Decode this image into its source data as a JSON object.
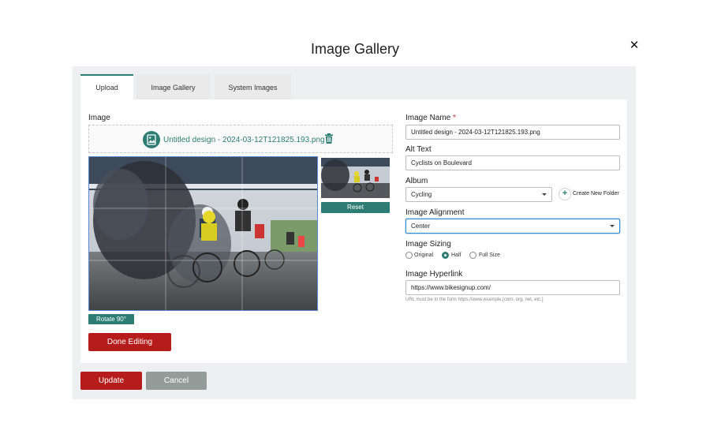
{
  "modal": {
    "title": "Image Gallery",
    "close_glyph": "✕"
  },
  "tabs": [
    {
      "label": "Upload",
      "active": true
    },
    {
      "label": "Image Gallery",
      "active": false
    },
    {
      "label": "System Images",
      "active": false
    }
  ],
  "left": {
    "image_label": "Image",
    "file_name": "Untitled design - 2024-03-12T121825.193.png",
    "reset_label": "Reset",
    "rotate_label": "Rotate 90°",
    "done_label": "Done Editing"
  },
  "right": {
    "image_name": {
      "label": "Image Name",
      "required_mark": "*",
      "value": "Untitled design - 2024-03-12T121825.193.png"
    },
    "alt_text": {
      "label": "Alt Text",
      "value": "Cyclists on Boulevard"
    },
    "album": {
      "label": "Album",
      "value": "Cycling",
      "create_folder_label": "Create New Folder"
    },
    "alignment": {
      "label": "Image Alignment",
      "value": "Center"
    },
    "sizing": {
      "label": "Image Sizing",
      "options": [
        "Original",
        "Half",
        "Full Size"
      ],
      "selected": "Half"
    },
    "hyperlink": {
      "label": "Image Hyperlink",
      "value": "https://www.bikesignup.com/",
      "hint": "URL must be in the form https://www.example.[com, org, net, etc.]"
    }
  },
  "footer": {
    "update_label": "Update",
    "cancel_label": "Cancel"
  },
  "colors": {
    "accent": "#2e7d74",
    "danger": "#b71c1c",
    "neutral": "#949c9a",
    "focus": "#2e8bd6"
  }
}
